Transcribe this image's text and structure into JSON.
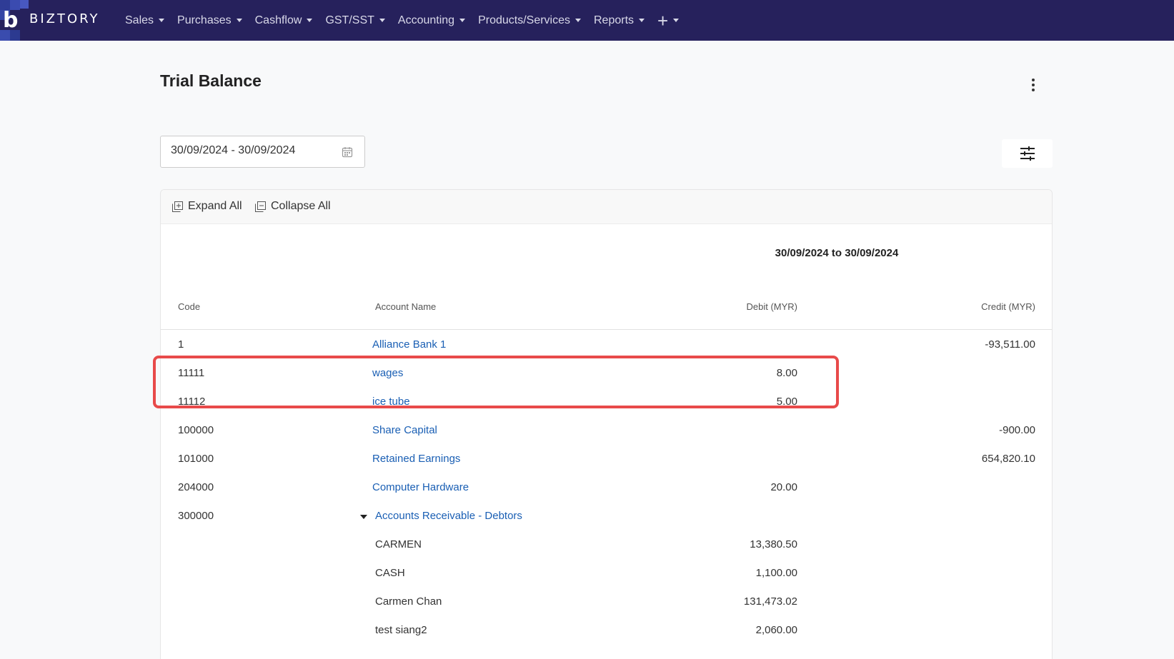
{
  "nav": {
    "logo": "BIZTORY",
    "items": [
      {
        "label": "Sales"
      },
      {
        "label": "Purchases"
      },
      {
        "label": "Cashflow"
      },
      {
        "label": "GST/SST"
      },
      {
        "label": "Accounting"
      },
      {
        "label": "Products/Services"
      },
      {
        "label": "Reports"
      }
    ],
    "plus": "+"
  },
  "page": {
    "title": "Trial Balance",
    "date_range": "30/09/2024 - 30/09/2024"
  },
  "toolbar": {
    "expand_label": "Expand All",
    "collapse_label": "Collapse All"
  },
  "report": {
    "period": "30/09/2024 to 30/09/2024",
    "columns": {
      "code": "Code",
      "account_name": "Account Name",
      "debit": "Debit (MYR)",
      "credit": "Credit (MYR)"
    },
    "rows": [
      {
        "code": "1",
        "name": "Alliance Bank 1",
        "debit": "",
        "credit": "-93,511.00"
      },
      {
        "code": "11111",
        "name": "wages",
        "debit": "8.00",
        "credit": ""
      },
      {
        "code": "11112",
        "name": "ice tube",
        "debit": "5.00",
        "credit": ""
      },
      {
        "code": "100000",
        "name": "Share Capital",
        "debit": "",
        "credit": "-900.00"
      },
      {
        "code": "101000",
        "name": "Retained Earnings",
        "debit": "",
        "credit": "654,820.10"
      },
      {
        "code": "204000",
        "name": "Computer Hardware",
        "debit": "20.00",
        "credit": ""
      },
      {
        "code": "300000",
        "name": "Accounts Receivable - Debtors",
        "debit": "",
        "credit": ""
      }
    ],
    "sub_rows": [
      {
        "name": "CARMEN",
        "debit": "13,380.50"
      },
      {
        "name": "CASH",
        "debit": "1,100.00"
      },
      {
        "name": "Carmen Chan",
        "debit": "131,473.02"
      },
      {
        "name": "test siang2",
        "debit": "2,060.00"
      }
    ]
  },
  "colors": {
    "navbar": "#26215c",
    "link": "#1a5fb4",
    "highlight": "#e84a4a"
  }
}
